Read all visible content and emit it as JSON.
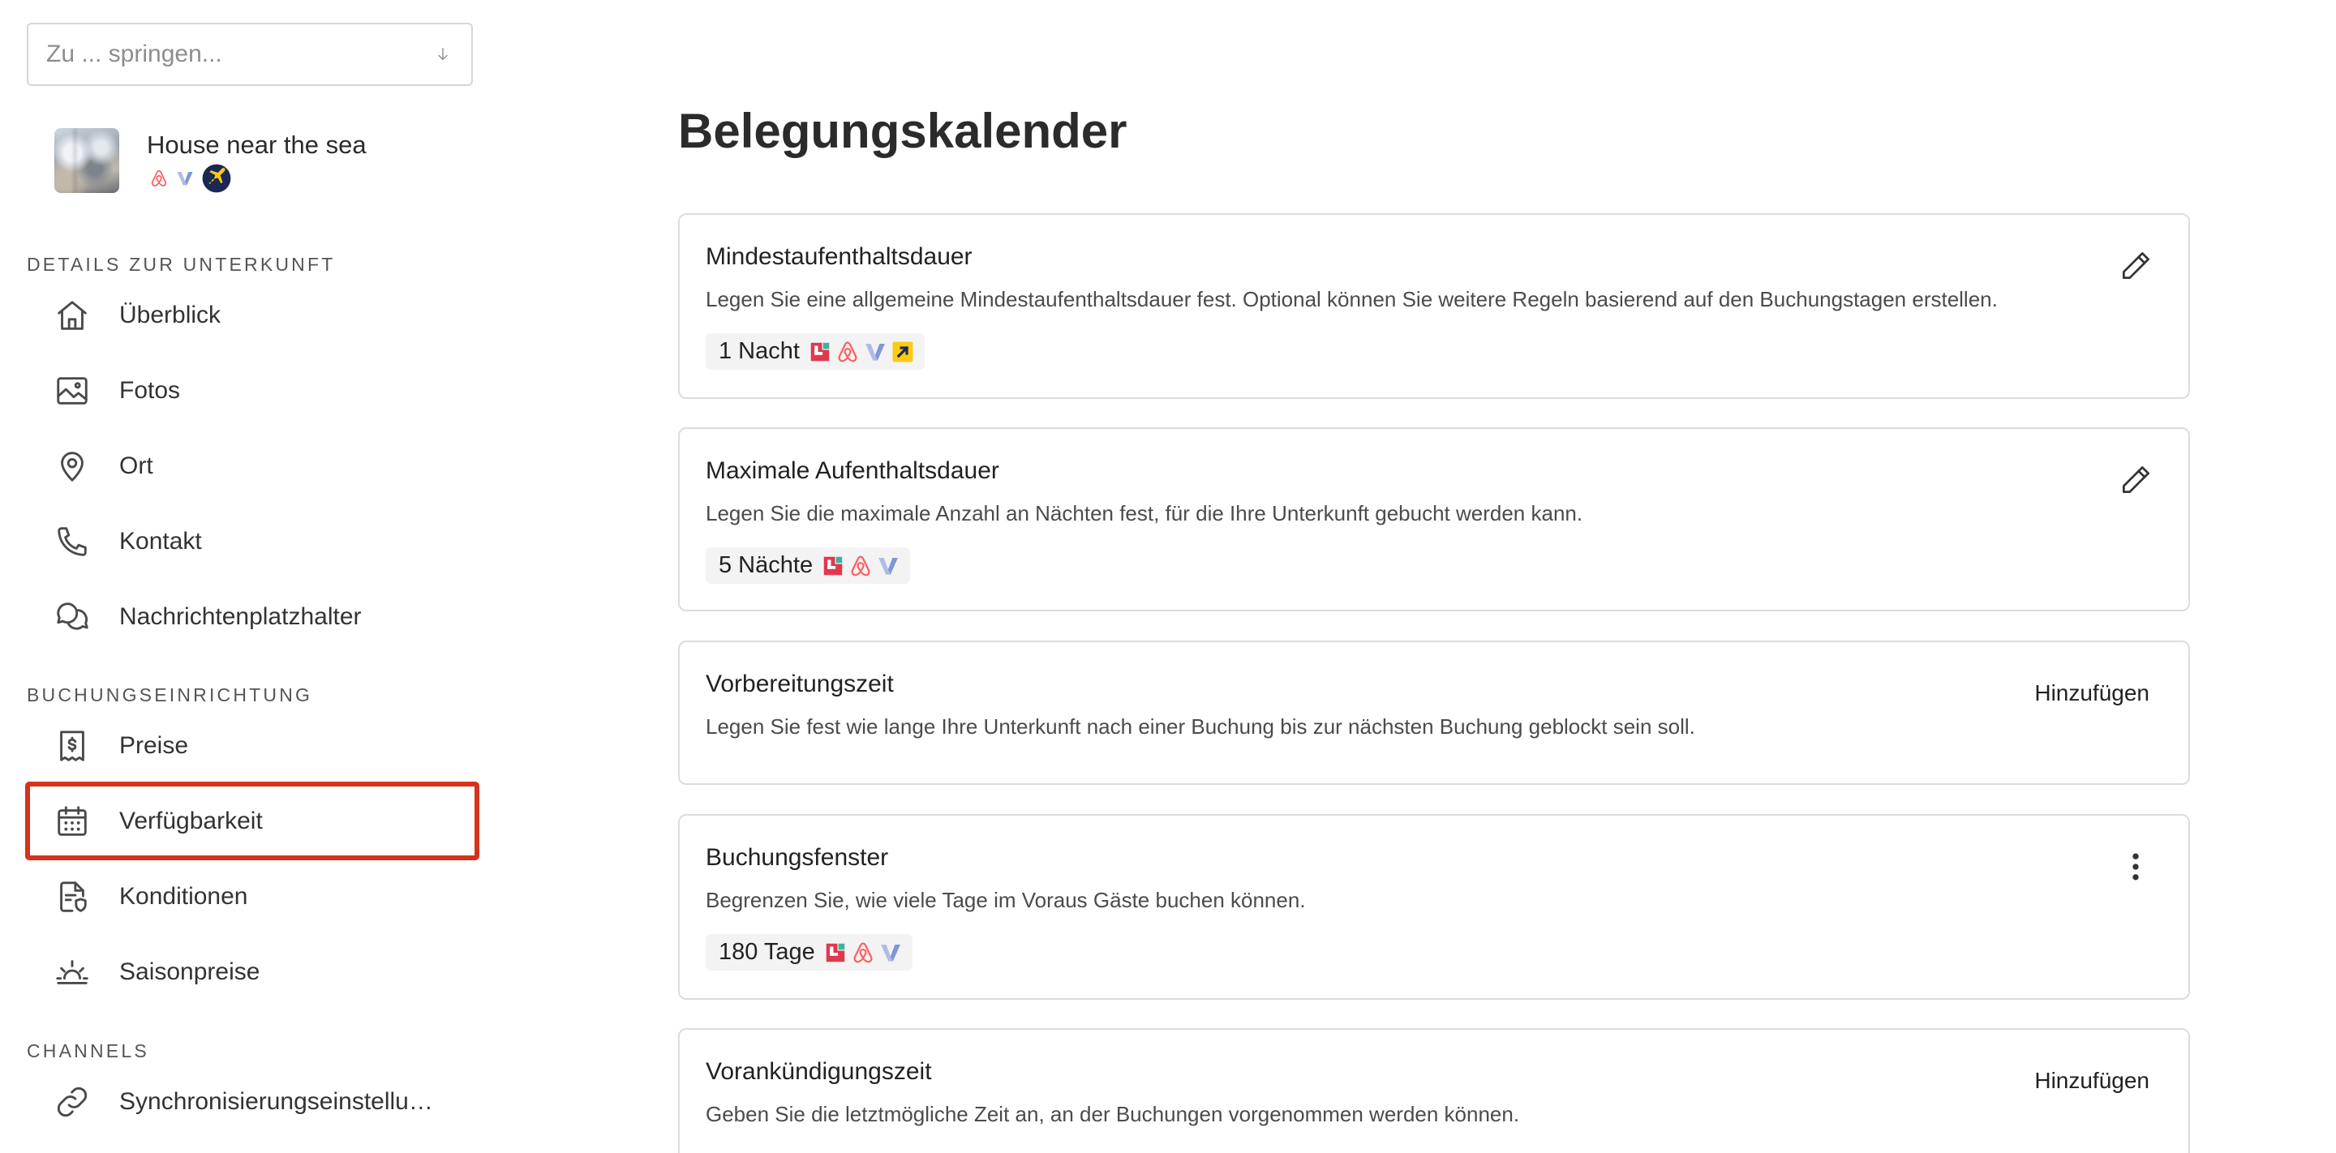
{
  "theme": {
    "highlight": "#d5331d"
  },
  "sidebar": {
    "jump": {
      "placeholder": "Zu ... springen...",
      "icon": "arrow-down-icon"
    },
    "property": {
      "name": "House near the sea",
      "channels": [
        "airbnb-icon",
        "vrbo-icon",
        "expedia-circle-icon"
      ]
    },
    "sections": [
      {
        "title": "DETAILS ZUR UNTERKUNFT",
        "items": [
          {
            "label": "Überblick",
            "icon": "home-icon"
          },
          {
            "label": "Fotos",
            "icon": "image-icon"
          },
          {
            "label": "Ort",
            "icon": "map-pin-icon"
          },
          {
            "label": "Kontakt",
            "icon": "phone-icon"
          },
          {
            "label": "Nachrichtenplatzhalter",
            "icon": "chat-bubbles-icon"
          }
        ]
      },
      {
        "title": "BUCHUNGSEINRICHTUNG",
        "items": [
          {
            "label": "Preise",
            "icon": "price-receipt-icon"
          },
          {
            "label": "Verfügbarkeit",
            "icon": "calendar-icon"
          },
          {
            "label": "Konditionen",
            "icon": "document-shield-icon"
          },
          {
            "label": "Saisonpreise",
            "icon": "sunrise-icon"
          }
        ]
      },
      {
        "title": "CHANNELS",
        "items": [
          {
            "label": "Synchronisierungseinstellu…",
            "icon": "link-icon"
          }
        ]
      }
    ]
  },
  "main": {
    "title": "Belegungskalender",
    "cards": [
      {
        "title": "Mindestaufenthaltsdauer",
        "description": "Legen Sie eine allgemeine Mindestaufenthaltsdauer fest. Optional können Sie weitere Regeln basierend auf den Buchungstagen erstellen.",
        "value": "1 Nacht",
        "channels": [
          "channel-red-icon",
          "airbnb-icon",
          "vrbo-icon",
          "expedia-square-icon"
        ],
        "action": {
          "icon": "pencil-icon"
        }
      },
      {
        "title": "Maximale Aufenthaltsdauer",
        "description": "Legen Sie die maximale Anzahl an Nächten fest, für die Ihre Unterkunft gebucht werden kann.",
        "value": "5 Nächte",
        "channels": [
          "channel-red-icon",
          "airbnb-icon",
          "vrbo-icon"
        ],
        "action": {
          "icon": "pencil-icon"
        }
      },
      {
        "title": "Vorbereitungszeit",
        "description": "Legen Sie fest wie lange Ihre Unterkunft nach einer Buchung bis zur nächsten Buchung geblockt sein soll.",
        "action": {
          "label": "Hinzufügen"
        }
      },
      {
        "title": "Buchungsfenster",
        "description": "Begrenzen Sie, wie viele Tage im Voraus Gäste buchen können.",
        "value": "180 Tage",
        "channels": [
          "channel-red-icon",
          "airbnb-icon",
          "vrbo-icon"
        ],
        "action": {
          "icon": "more-vertical-icon"
        }
      },
      {
        "title": "Vorankündigungszeit",
        "description": "Geben Sie die letztmögliche Zeit an, an der Buchungen vorgenommen werden können.",
        "action": {
          "label": "Hinzufügen"
        }
      }
    ]
  }
}
